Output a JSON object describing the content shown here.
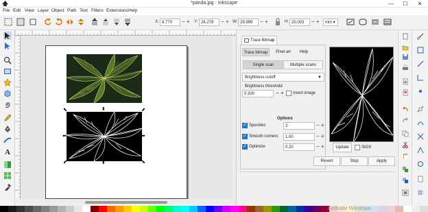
{
  "window": {
    "title": "*panda.jpg - Inkscape",
    "minimize": "—",
    "maximize": "☐",
    "close": "✕"
  },
  "menu": [
    "File",
    "Edit",
    "View",
    "Layer",
    "Object",
    "Path",
    "Text",
    "Filters",
    "Extensions",
    "Help"
  ],
  "toolbar": {
    "x_label": "X:",
    "x_value": "8.770",
    "y_label": "Y:",
    "y_value": "26.278",
    "w_label": "W:",
    "w_value": "29.999",
    "h_label": "H:",
    "h_value": "20.003",
    "unit": "mm",
    "plus": "+",
    "minus": "−",
    "lock_icon": "lock-icon"
  },
  "dock": {
    "tab_label": "Trace Bitmap",
    "tab_close": "✕",
    "subtabs": [
      "Trace bitmap",
      "Pixel art",
      "Help"
    ],
    "modes": [
      "Single scan",
      "Multiple scans"
    ],
    "method": "Brightness cutoff",
    "threshold_label": "Brightness threshold",
    "threshold_value": "0.300",
    "invert_label": "Invert image",
    "options_label": "Options",
    "speckles_label": "Speckles",
    "speckles_value": "2",
    "smooth_label": "Smooth corners",
    "smooth_value": "1.00",
    "optimize_label": "Optimize",
    "optimize_value": "0.20",
    "update_label": "Update",
    "siox_label": "SIOX",
    "revert_label": "Revert",
    "stop_label": "Stop",
    "apply_label": "Apply"
  },
  "watermark": "Activate Windows",
  "colors": {
    "accent": "#2d71c8",
    "photo_bg": "#24331c",
    "leaf_fill": "#3f5c24",
    "leaf_vein": "#cfd96a",
    "trace_bg": "#000000",
    "trace_line": "#ffffff"
  },
  "palette": [
    "#000000",
    "#1a1a1a",
    "#333333",
    "#4d4d4d",
    "#666666",
    "#808080",
    "#999999",
    "#b3b3b3",
    "#cccccc",
    "#e6e6e6",
    "#ffffff",
    "#800000",
    "#ff0000",
    "#ff6600",
    "#ff9900",
    "#ffcc00",
    "#ffff00",
    "#ccff00",
    "#66ff00",
    "#00ff00",
    "#00ff66",
    "#00ffcc",
    "#00ffff",
    "#00ccff",
    "#0066ff",
    "#0000ff",
    "#6600ff",
    "#cc00ff",
    "#ff00ff",
    "#ff0099",
    "#993300",
    "#996633",
    "#999900",
    "#339900",
    "#006633",
    "#006699",
    "#003399",
    "#330099",
    "#660066",
    "#990033",
    "#f4cccc",
    "#fce5cd",
    "#fff2cc",
    "#d9ead3",
    "#d0e0e3",
    "#cfe2f3",
    "#d9d2e9",
    "#ead1dc",
    "#e6b8af",
    "#ffffff",
    "#eeeeee",
    "#dddddd"
  ]
}
